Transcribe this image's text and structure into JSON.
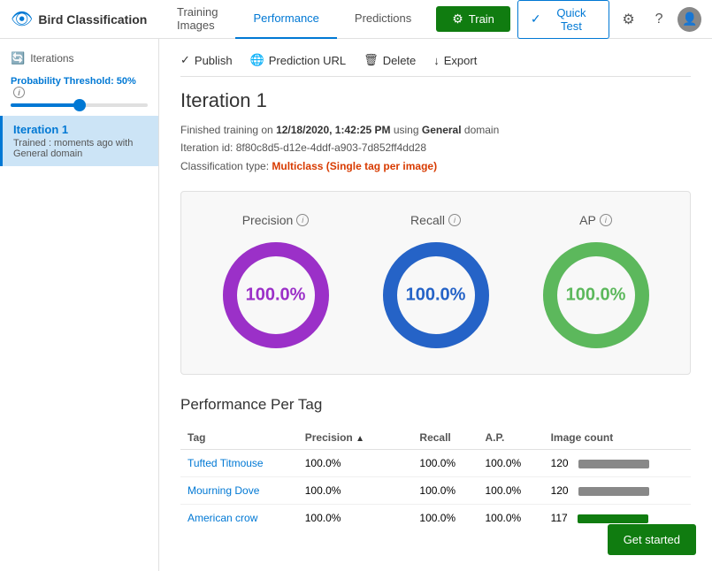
{
  "app": {
    "title": "Bird Classification",
    "logo_icon": "🐦"
  },
  "nav": {
    "tabs": [
      {
        "label": "Training Images",
        "active": false
      },
      {
        "label": "Performance",
        "active": true
      },
      {
        "label": "Predictions",
        "active": false
      }
    ],
    "train_label": "Train",
    "quicktest_label": "Quick Test"
  },
  "sidebar": {
    "iterations_label": "Iterations",
    "prob_threshold_label": "Probability Threshold:",
    "prob_threshold_value": "50%",
    "iteration": {
      "title": "Iteration 1",
      "trained_label": "Trained : moments ago with",
      "domain": "General domain"
    }
  },
  "toolbar": {
    "publish_label": "Publish",
    "prediction_url_label": "Prediction URL",
    "delete_label": "Delete",
    "export_label": "Export"
  },
  "content": {
    "iteration_title": "Iteration 1",
    "meta_line1_prefix": "Finished training on ",
    "meta_date": "12/18/2020, 1:42:25 PM",
    "meta_line1_suffix": " using ",
    "meta_domain": "General",
    "meta_domain_suffix": " domain",
    "meta_line2_prefix": "Iteration id: ",
    "meta_iteration_id": "8f80c8d5-d12e-4ddf-a903-7d852ff4dd28",
    "meta_line3_prefix": "Classification type: ",
    "meta_classification": "Multiclass (Single tag per image)",
    "metrics": {
      "precision": {
        "label": "Precision",
        "value": "100.0%",
        "color": "#9b30c8"
      },
      "recall": {
        "label": "Recall",
        "value": "100.0%",
        "color": "#2563c7"
      },
      "ap": {
        "label": "AP",
        "value": "100.0%",
        "color": "#5cb85c"
      }
    },
    "perf_per_tag_title": "Performance Per Tag",
    "table_headers": [
      "Tag",
      "Precision",
      "",
      "Recall",
      "A.P.",
      "Image count"
    ],
    "table_rows": [
      {
        "tag": "Tufted Titmouse",
        "precision": "100.0%",
        "recall": "100.0%",
        "ap": "100.0%",
        "image_count": "120",
        "bar_type": "gray"
      },
      {
        "tag": "Mourning Dove",
        "precision": "100.0%",
        "recall": "100.0%",
        "ap": "100.0%",
        "image_count": "120",
        "bar_type": "gray"
      },
      {
        "tag": "American crow",
        "precision": "100.0%",
        "recall": "100.0%",
        "ap": "100.0%",
        "image_count": "117",
        "bar_type": "green"
      }
    ]
  },
  "get_started_label": "Get started"
}
